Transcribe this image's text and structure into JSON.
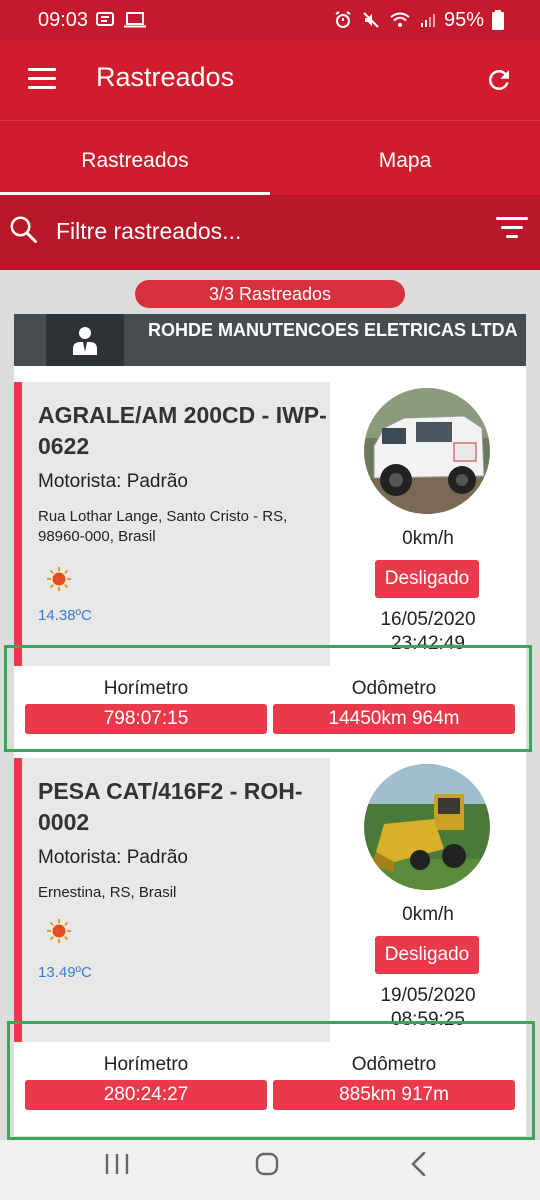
{
  "status_bar": {
    "time": "09:03",
    "battery": "95%"
  },
  "app_bar": {
    "title": "Rastreados"
  },
  "tabs": [
    {
      "label": "Rastreados",
      "active": true
    },
    {
      "label": "Mapa",
      "active": false
    }
  ],
  "search": {
    "placeholder": "Filtre rastreados..."
  },
  "counter": "3/3 Rastreados",
  "group": {
    "name": "ROHDE MANUTENCOES ELETRICAS LTDA"
  },
  "vehicles": [
    {
      "title": "AGRALE/AM 200CD - IWP-0622",
      "driver": "Motorista: Padrão",
      "address": "Rua Lothar Lange, Santo Cristo - RS, 98960-000, Brasil",
      "temperature": "14.38ºC",
      "speed": "0km/h",
      "status": "Desligado",
      "date": "16/05/2020",
      "time": "23:42:49",
      "hourmeter_label": "Horímetro",
      "hourmeter_value": "798:07:15",
      "odometer_label": "Odômetro",
      "odometer_value": "14450km 964m"
    },
    {
      "title": "PESA CAT/416F2 - ROH-0002",
      "driver": "Motorista: Padrão",
      "address": "Ernestina, RS, Brasil",
      "temperature": "13.49ºC",
      "speed": "0km/h",
      "status": "Desligado",
      "date": "19/05/2020",
      "time": "08:59:25",
      "hourmeter_label": "Horímetro",
      "hourmeter_value": "280:24:27",
      "odometer_label": "Odômetro",
      "odometer_value": "885km 917m"
    }
  ],
  "colors": {
    "primary": "#d01c2c",
    "accent": "#e83a4a",
    "highlight": "#3aa655"
  },
  "icons": [
    "hamburger-menu-icon",
    "refresh-icon",
    "search-icon",
    "filter-icon",
    "sun-icon",
    "person-icon"
  ]
}
